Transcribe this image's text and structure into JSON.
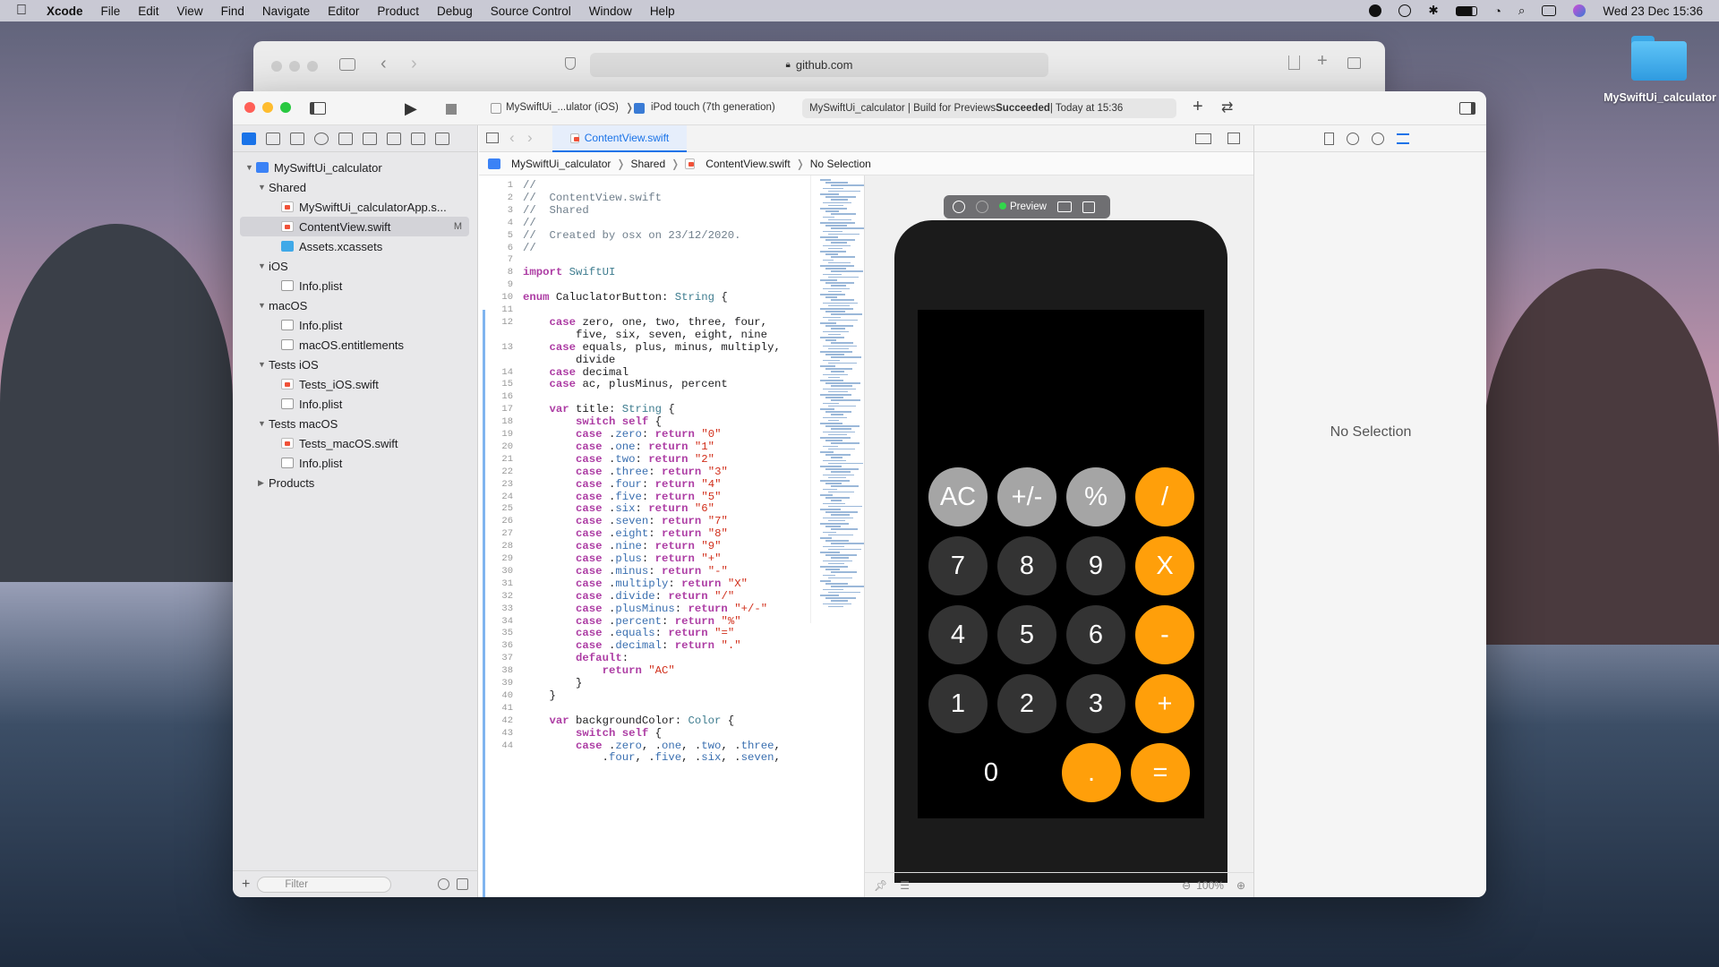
{
  "menubar": {
    "app": "Xcode",
    "items": [
      "File",
      "Edit",
      "View",
      "Find",
      "Navigate",
      "Editor",
      "Product",
      "Debug",
      "Source Control",
      "Window",
      "Help"
    ],
    "clock": "Wed 23 Dec  15:36"
  },
  "browser": {
    "url": "github.com"
  },
  "desktop": {
    "folder_label": "MySwiftUi_calculator"
  },
  "toolbar": {
    "scheme": "MySwiftUi_...ulator (iOS)",
    "device": "iPod touch (7th generation)",
    "status_prefix": "MySwiftUi_calculator | Build for Previews ",
    "status_result": "Succeeded",
    "status_suffix": " | Today at 15:36"
  },
  "navigator": {
    "filter_placeholder": "Filter",
    "items": [
      {
        "label": "MySwiftUi_calculator",
        "icon": "project-icon",
        "indent": 0,
        "open": true
      },
      {
        "label": "Shared",
        "icon": "folder-icon",
        "indent": 1,
        "open": true
      },
      {
        "label": "MySwiftUi_calculatorApp.s...",
        "icon": "swift-file-icon",
        "indent": 2
      },
      {
        "label": "ContentView.swift",
        "icon": "swift-file-icon",
        "indent": 2,
        "selected": true,
        "badge": "M"
      },
      {
        "label": "Assets.xcassets",
        "icon": "assets-icon",
        "indent": 2
      },
      {
        "label": "iOS",
        "icon": "folder-icon",
        "indent": 1,
        "open": true
      },
      {
        "label": "Info.plist",
        "icon": "plist-icon",
        "indent": 2
      },
      {
        "label": "macOS",
        "icon": "folder-icon",
        "indent": 1,
        "open": true
      },
      {
        "label": "Info.plist",
        "icon": "plist-icon",
        "indent": 2
      },
      {
        "label": "macOS.entitlements",
        "icon": "entitlements-icon",
        "indent": 2
      },
      {
        "label": "Tests iOS",
        "icon": "folder-icon",
        "indent": 1,
        "open": true
      },
      {
        "label": "Tests_iOS.swift",
        "icon": "swift-file-icon",
        "indent": 2
      },
      {
        "label": "Info.plist",
        "icon": "plist-icon",
        "indent": 2
      },
      {
        "label": "Tests macOS",
        "icon": "folder-icon",
        "indent": 1,
        "open": true
      },
      {
        "label": "Tests_macOS.swift",
        "icon": "swift-file-icon",
        "indent": 2
      },
      {
        "label": "Info.plist",
        "icon": "plist-icon",
        "indent": 2
      },
      {
        "label": "Products",
        "icon": "folder-icon",
        "indent": 1,
        "open": false
      }
    ]
  },
  "editor": {
    "tab": "ContentView.swift",
    "breadcrumb": [
      "MySwiftUi_calculator",
      "Shared",
      "ContentView.swift",
      "No Selection"
    ],
    "lines": [
      {
        "n": "1",
        "t": "//"
      },
      {
        "n": "2",
        "t": "//  ContentView.swift"
      },
      {
        "n": "3",
        "t": "//  Shared"
      },
      {
        "n": "4",
        "t": "//"
      },
      {
        "n": "5",
        "t": "//  Created by osx on 23/12/2020."
      },
      {
        "n": "6",
        "t": "//"
      },
      {
        "n": "7",
        "t": ""
      },
      {
        "n": "8",
        "t": "import SwiftUI"
      },
      {
        "n": "9",
        "t": ""
      },
      {
        "n": "10",
        "t": "enum CaluclatorButton: String {"
      },
      {
        "n": "11",
        "t": ""
      },
      {
        "n": "12",
        "t": "    case zero, one, two, three, four,"
      },
      {
        "n": "",
        "t": "        five, six, seven, eight, nine"
      },
      {
        "n": "13",
        "t": "    case equals, plus, minus, multiply,"
      },
      {
        "n": "",
        "t": "        divide"
      },
      {
        "n": "14",
        "t": "    case decimal"
      },
      {
        "n": "15",
        "t": "    case ac, plusMinus, percent"
      },
      {
        "n": "16",
        "t": ""
      },
      {
        "n": "17",
        "t": "    var title: String {"
      },
      {
        "n": "18",
        "t": "        switch self {"
      },
      {
        "n": "19",
        "t": "        case .zero: return \"0\""
      },
      {
        "n": "20",
        "t": "        case .one: return \"1\""
      },
      {
        "n": "21",
        "t": "        case .two: return \"2\""
      },
      {
        "n": "22",
        "t": "        case .three: return \"3\""
      },
      {
        "n": "23",
        "t": "        case .four: return \"4\""
      },
      {
        "n": "24",
        "t": "        case .five: return \"5\""
      },
      {
        "n": "25",
        "t": "        case .six: return \"6\""
      },
      {
        "n": "26",
        "t": "        case .seven: return \"7\""
      },
      {
        "n": "27",
        "t": "        case .eight: return \"8\""
      },
      {
        "n": "28",
        "t": "        case .nine: return \"9\""
      },
      {
        "n": "29",
        "t": "        case .plus: return \"+\""
      },
      {
        "n": "30",
        "t": "        case .minus: return \"-\""
      },
      {
        "n": "31",
        "t": "        case .multiply: return \"X\""
      },
      {
        "n": "32",
        "t": "        case .divide: return \"/\""
      },
      {
        "n": "33",
        "t": "        case .plusMinus: return \"+/-\""
      },
      {
        "n": "34",
        "t": "        case .percent: return \"%\""
      },
      {
        "n": "35",
        "t": "        case .equals: return \"=\""
      },
      {
        "n": "36",
        "t": "        case .decimal: return \".\""
      },
      {
        "n": "37",
        "t": "        default:"
      },
      {
        "n": "38",
        "t": "            return \"AC\""
      },
      {
        "n": "39",
        "t": "        }"
      },
      {
        "n": "40",
        "t": "    }"
      },
      {
        "n": "41",
        "t": ""
      },
      {
        "n": "42",
        "t": "    var backgroundColor: Color {"
      },
      {
        "n": "43",
        "t": "        switch self {"
      },
      {
        "n": "44",
        "t": "        case .zero, .one, .two, .three,"
      },
      {
        "n": "",
        "t": "            .four, .five, .six, .seven,"
      }
    ]
  },
  "canvas": {
    "preview_label": "Preview",
    "zoom": "100%",
    "calculator": {
      "rows": [
        [
          {
            "t": "AC",
            "s": "light"
          },
          {
            "t": "+/-",
            "s": "light"
          },
          {
            "t": "%",
            "s": "light"
          },
          {
            "t": "/",
            "s": "orange"
          }
        ],
        [
          {
            "t": "7",
            "s": "dark"
          },
          {
            "t": "8",
            "s": "dark"
          },
          {
            "t": "9",
            "s": "dark"
          },
          {
            "t": "X",
            "s": "orange"
          }
        ],
        [
          {
            "t": "4",
            "s": "dark"
          },
          {
            "t": "5",
            "s": "dark"
          },
          {
            "t": "6",
            "s": "dark"
          },
          {
            "t": "-",
            "s": "orange"
          }
        ],
        [
          {
            "t": "1",
            "s": "dark"
          },
          {
            "t": "2",
            "s": "dark"
          },
          {
            "t": "3",
            "s": "dark"
          },
          {
            "t": "+",
            "s": "orange"
          }
        ],
        [
          {
            "t": "0",
            "s": "zero"
          },
          {
            "t": ".",
            "s": "orange"
          },
          {
            "t": "=",
            "s": "orange"
          }
        ]
      ]
    }
  },
  "inspector": {
    "empty_text": "No Selection"
  },
  "colors": {
    "accent": "#1a73e8",
    "operator_orange": "#ff9f0a",
    "digit_dark": "#333333",
    "function_light": "#a5a5a5"
  }
}
